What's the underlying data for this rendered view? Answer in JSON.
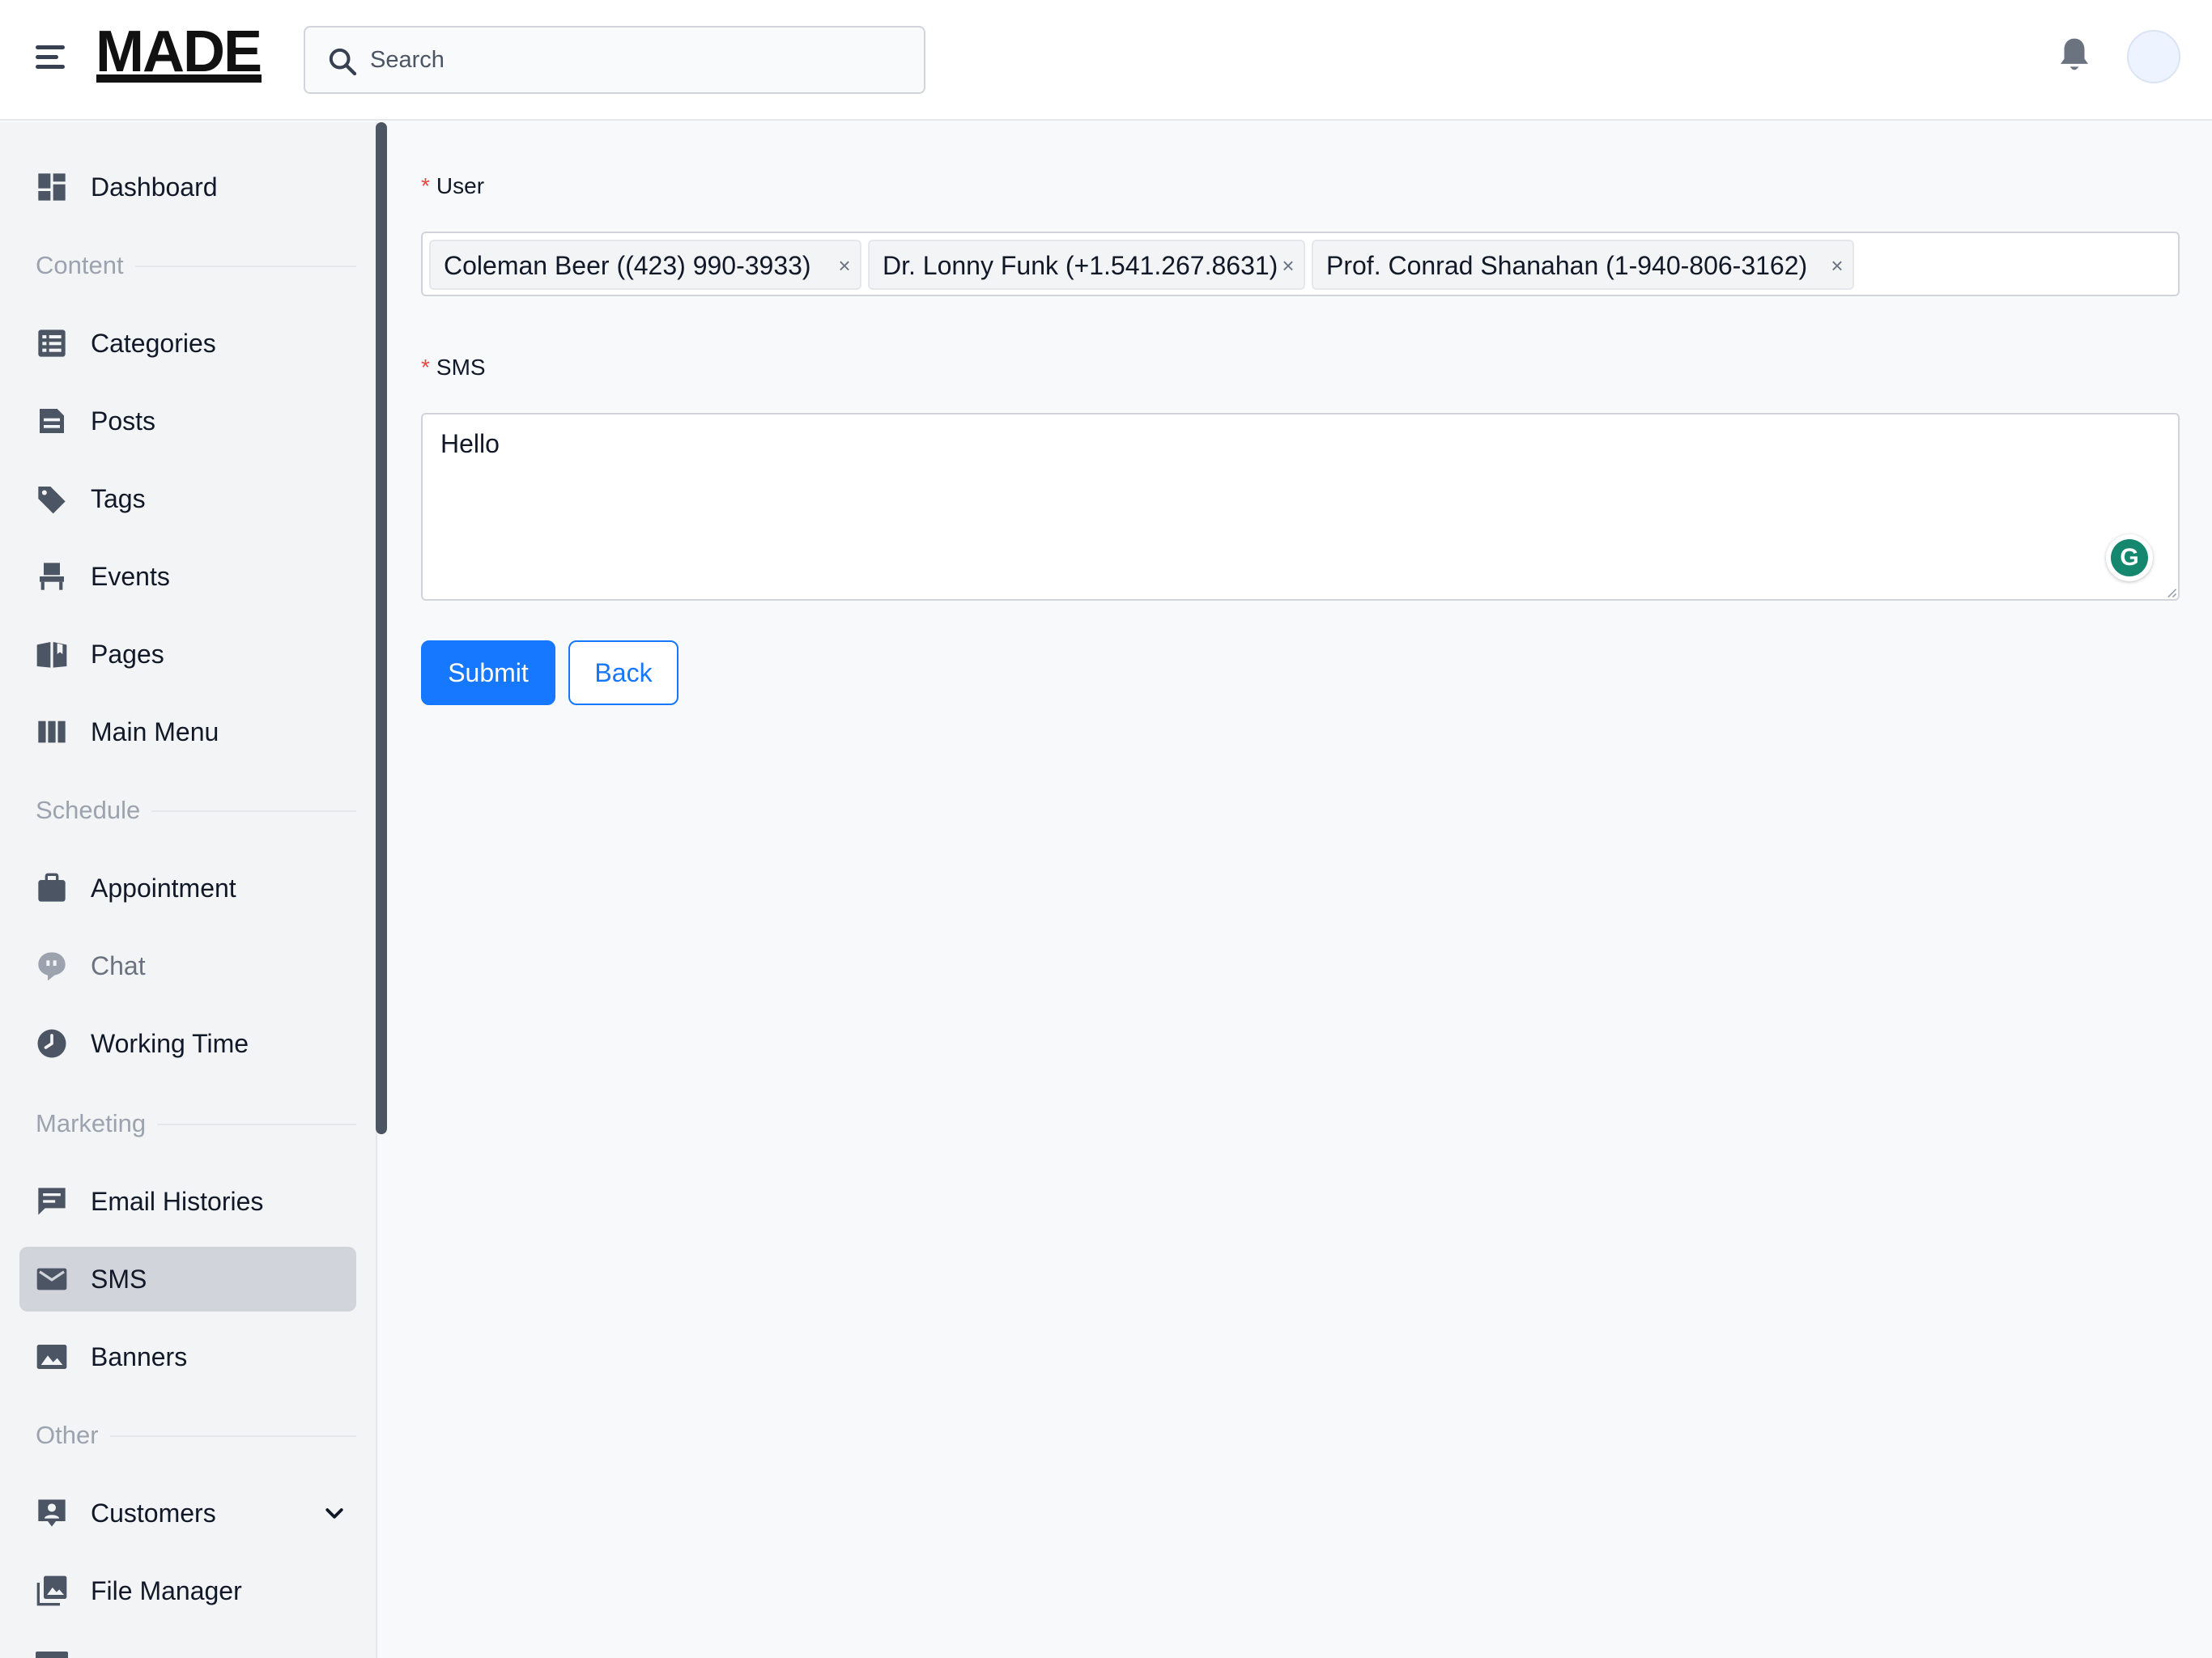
{
  "header": {
    "logo": "MADE",
    "search_placeholder": "Search"
  },
  "sidebar": {
    "items": [
      {
        "label": "Dashboard",
        "icon": "dashboard-icon"
      },
      {
        "section": "Content"
      },
      {
        "label": "Categories",
        "icon": "list-icon"
      },
      {
        "label": "Posts",
        "icon": "post-icon"
      },
      {
        "label": "Tags",
        "icon": "tag-icon"
      },
      {
        "label": "Events",
        "icon": "chair-icon"
      },
      {
        "label": "Pages",
        "icon": "book-icon"
      },
      {
        "label": "Main Menu",
        "icon": "columns-icon"
      },
      {
        "section": "Schedule"
      },
      {
        "label": "Appointment",
        "icon": "briefcase-icon"
      },
      {
        "label": "Chat",
        "icon": "chat-icon"
      },
      {
        "label": "Working Time",
        "icon": "clock-icon"
      },
      {
        "section": "Marketing"
      },
      {
        "label": "Email Histories",
        "icon": "message-icon"
      },
      {
        "label": "SMS",
        "icon": "envelope-icon",
        "active": true
      },
      {
        "label": "Banners",
        "icon": "image-icon"
      },
      {
        "section": "Other"
      },
      {
        "label": "Customers",
        "icon": "contact-icon"
      },
      {
        "label": "File Manager",
        "icon": "photo-library-icon"
      }
    ]
  },
  "form": {
    "user_label": "User",
    "required_mark": "*",
    "selected_users": [
      "Coleman Beer ((423) 990-3933)",
      "Dr. Lonny Funk (+1.541.267.8631)",
      "Prof. Conrad Shanahan (1-940-806-3162)"
    ],
    "tag_remove": "×",
    "sms_label": "SMS",
    "sms_value": "Hello",
    "grammarly_letter": "G",
    "submit_label": "Submit",
    "back_label": "Back"
  },
  "colors": {
    "primary": "#1677ff",
    "required": "#ef4444",
    "active_nav": "#d1d5db",
    "grammarly": "#15876e"
  }
}
